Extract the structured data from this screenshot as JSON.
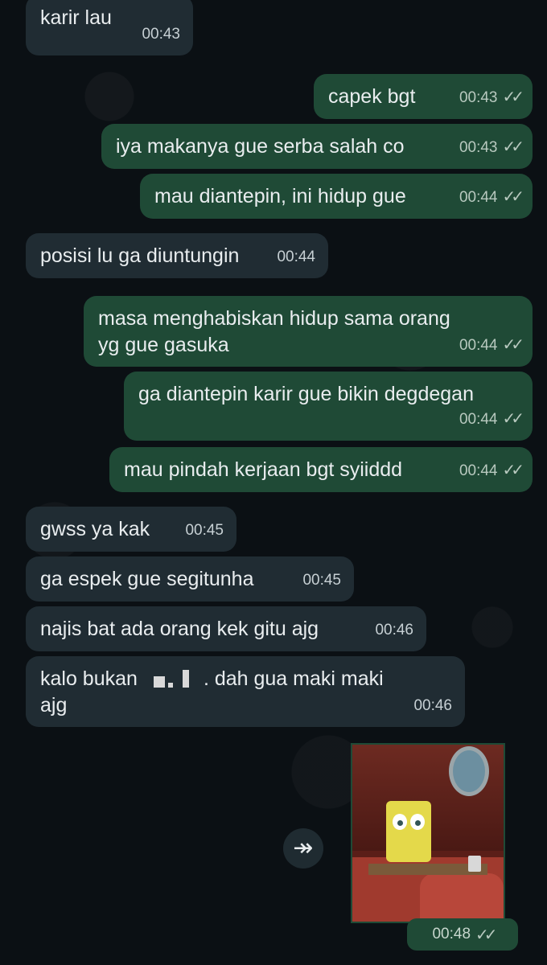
{
  "messages": [
    {
      "id": "b1",
      "direction": "incoming",
      "text": "karir lau",
      "time": "00:43"
    },
    {
      "id": "b2",
      "direction": "outgoing",
      "text": "capek bgt",
      "time": "00:43",
      "status": "read"
    },
    {
      "id": "b3",
      "direction": "outgoing",
      "text": "iya makanya gue serba salah co",
      "time": "00:43",
      "status": "read"
    },
    {
      "id": "b4",
      "direction": "outgoing",
      "text": "mau diantepin, ini hidup gue",
      "time": "00:44",
      "status": "read"
    },
    {
      "id": "b5",
      "direction": "incoming",
      "text": "posisi lu ga diuntungin",
      "time": "00:44"
    },
    {
      "id": "b6",
      "direction": "outgoing",
      "text": "masa menghabiskan hidup sama orang\nyg gue gasuka",
      "time": "00:44",
      "status": "read"
    },
    {
      "id": "b7",
      "direction": "outgoing",
      "text": "ga diantepin karir gue bikin degdegan",
      "time": "00:44",
      "status": "read"
    },
    {
      "id": "b8",
      "direction": "outgoing",
      "text": "mau pindah kerjaan bgt syiiddd",
      "time": "00:44",
      "status": "read"
    },
    {
      "id": "b9",
      "direction": "incoming",
      "text": "gwss ya kak",
      "time": "00:45"
    },
    {
      "id": "b10",
      "direction": "incoming",
      "text": "ga espek gue segitunha",
      "time": "00:45"
    },
    {
      "id": "b11",
      "direction": "incoming",
      "text": "najis bat ada orang kek gitu ajg",
      "time": "00:46"
    },
    {
      "id": "b12",
      "direction": "incoming",
      "text_before": "kalo bukan",
      "text_after": ". dah gua maki maki",
      "text_line2": "ajg",
      "time": "00:46"
    }
  ],
  "media_message": {
    "time": "00:48",
    "status": "read"
  },
  "colors": {
    "incoming": "#202c33",
    "outgoing": "#1f4a36",
    "background": "#0b1014"
  },
  "icons": {
    "forward": "forward-icon",
    "read_receipt": "double-check-icon"
  }
}
